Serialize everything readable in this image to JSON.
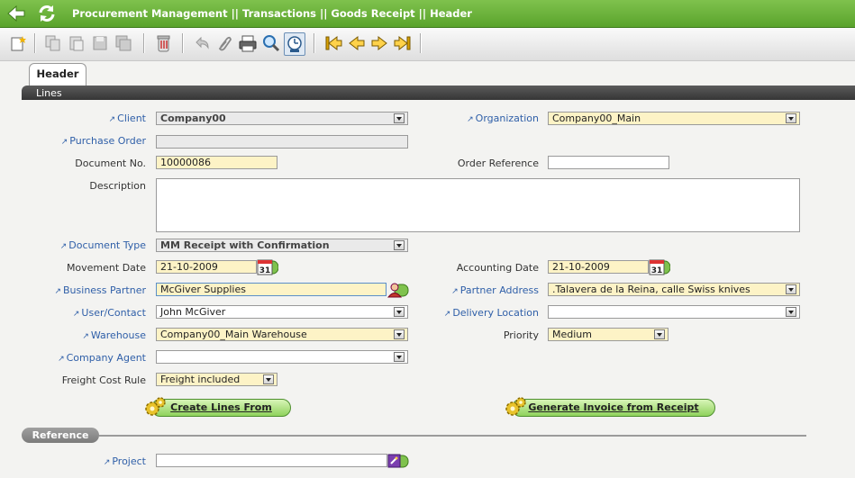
{
  "titlebar": {
    "title": "Procurement Management  ||  Transactions  ||  Goods Receipt   ||   Header",
    "back_icon": "back-arrow-icon",
    "refresh_icon": "refresh-icon"
  },
  "toolbar": {
    "icons": [
      "new-record-icon",
      "copy-icon",
      "paste-icon",
      "save-icon",
      "save-all-icon",
      "delete-icon",
      "undo-icon",
      "attachment-icon",
      "print-icon",
      "search-icon",
      "audit-icon",
      "first-record-icon",
      "previous-record-icon",
      "next-record-icon",
      "last-record-icon"
    ]
  },
  "tabs": {
    "header": "Header",
    "lines": "Lines"
  },
  "labels": {
    "client": "Client",
    "organization": "Organization",
    "purchase_order": "Purchase Order",
    "document_no": "Document No.",
    "order_reference": "Order Reference",
    "description": "Description",
    "document_type": "Document Type",
    "movement_date": "Movement Date",
    "accounting_date": "Accounting Date",
    "business_partner": "Business Partner",
    "partner_address": "Partner Address",
    "user_contact": "User/Contact",
    "delivery_location": "Delivery Location",
    "warehouse": "Warehouse",
    "priority": "Priority",
    "company_agent": "Company Agent",
    "freight_cost_rule": "Freight Cost Rule",
    "project": "Project"
  },
  "values": {
    "client": "Company00",
    "organization": "Company00_Main",
    "purchase_order": "",
    "document_no": "10000086",
    "order_reference": "",
    "description": "",
    "document_type": "MM Receipt with Confirmation",
    "movement_date": "21-10-2009",
    "accounting_date": "21-10-2009",
    "business_partner": "McGiver Supplies",
    "partner_address": ".Talavera de la Reina, calle Swiss knives",
    "user_contact": "John McGiver",
    "delivery_location": "",
    "warehouse": "Company00_Main Warehouse",
    "priority": "Medium",
    "company_agent": "",
    "freight_cost_rule": "Freight included",
    "project": ""
  },
  "calendar_day": "31",
  "buttons": {
    "create_lines_from": "Create Lines From",
    "generate_invoice": "Generate Invoice from Receipt"
  },
  "sections": {
    "reference": "Reference"
  },
  "colors": {
    "brand_green": "#5aa32c",
    "required_field": "#fdf3c6",
    "link_label": "#2f5fa8"
  }
}
